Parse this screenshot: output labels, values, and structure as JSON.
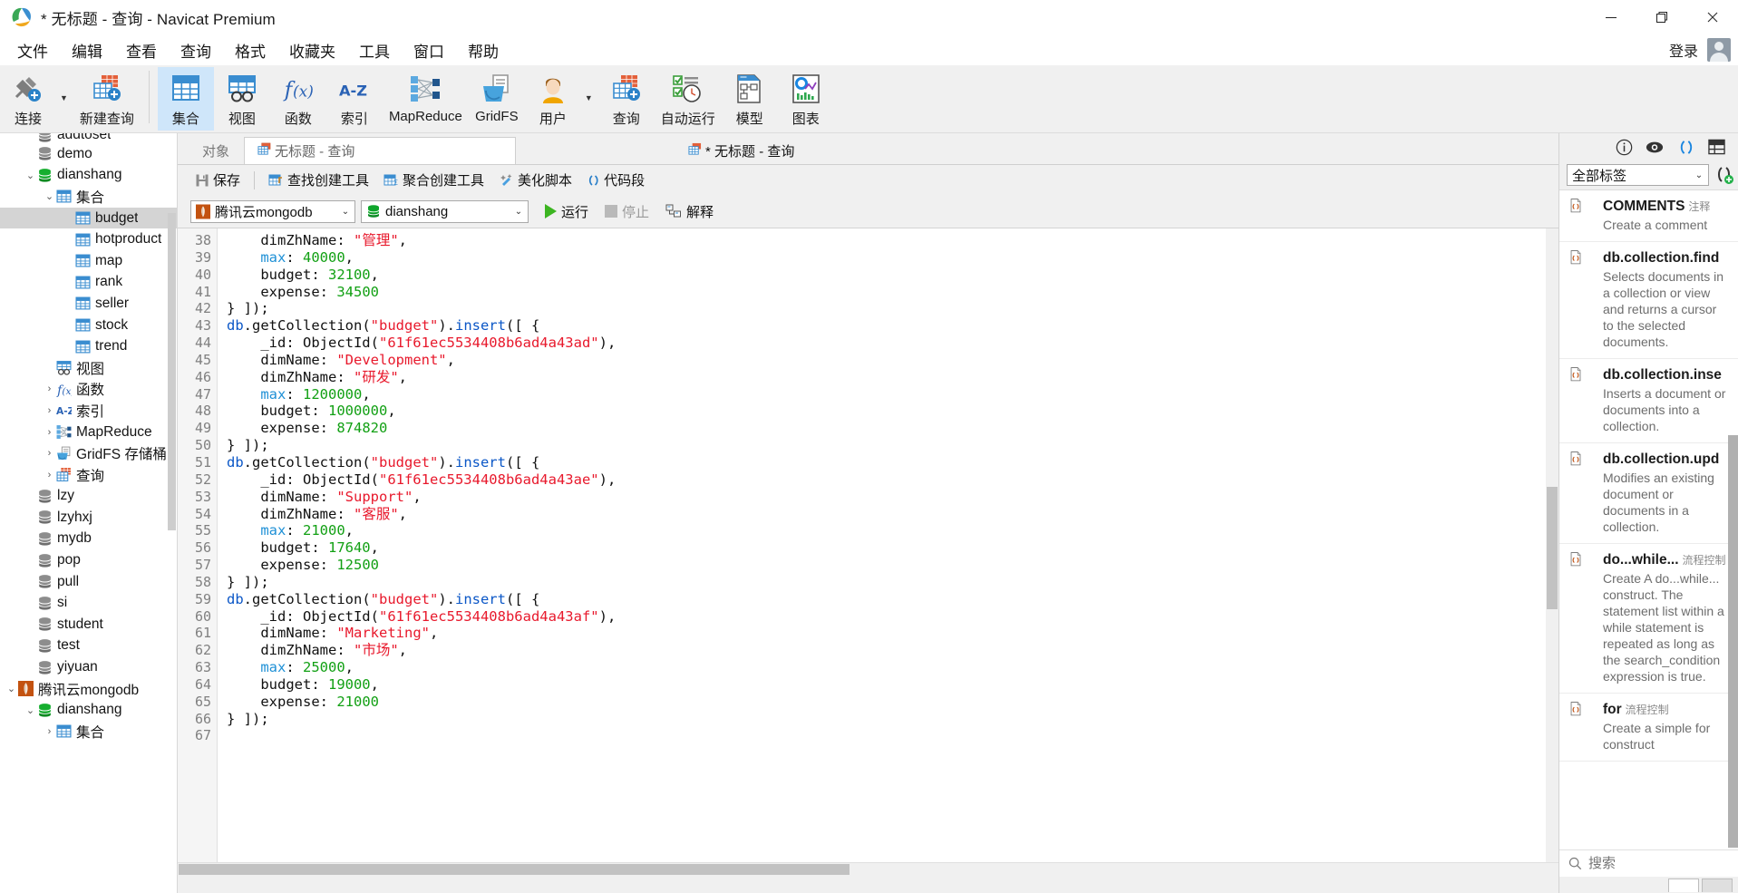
{
  "window": {
    "title": "* 无标题 - 查询 - Navicat Premium",
    "minimize": "—",
    "maximize": "❐",
    "close": "✕"
  },
  "menubar": {
    "items": [
      "文件",
      "编辑",
      "查看",
      "查询",
      "格式",
      "收藏夹",
      "工具",
      "窗口",
      "帮助"
    ],
    "login_label": "登录"
  },
  "ribbon": {
    "groups": [
      {
        "items": [
          {
            "label": "连接",
            "icon": "connection-plus-icon",
            "caret": true
          },
          {
            "label": "新建查询",
            "icon": "new-query-icon",
            "caret": false
          }
        ]
      },
      {
        "items": [
          {
            "label": "集合",
            "icon": "collection-icon",
            "active": true,
            "caret": false
          },
          {
            "label": "视图",
            "icon": "view-icon",
            "caret": false
          },
          {
            "label": "函数",
            "icon": "function-fx-icon",
            "caret": false
          },
          {
            "label": "索引",
            "icon": "index-az-icon",
            "caret": false
          },
          {
            "label": "MapReduce",
            "icon": "mapreduce-icon",
            "caret": false
          },
          {
            "label": "GridFS",
            "icon": "gridfs-bucket-icon",
            "caret": false
          },
          {
            "label": "用户",
            "icon": "user-icon",
            "caret": true
          },
          {
            "label": "查询",
            "icon": "query-icon",
            "caret": false
          },
          {
            "label": "自动运行",
            "icon": "automation-clock-icon",
            "caret": false
          },
          {
            "label": "模型",
            "icon": "model-diagram-icon",
            "caret": false
          },
          {
            "label": "图表",
            "icon": "chart-icon",
            "caret": false
          }
        ]
      }
    ]
  },
  "sidebar": {
    "nodes": [
      {
        "label": "addtoset",
        "icon": "database-grey-icon",
        "indent": 1,
        "arrow": "",
        "partial": true
      },
      {
        "label": "demo",
        "icon": "database-grey-icon",
        "indent": 1,
        "arrow": ""
      },
      {
        "label": "dianshang",
        "icon": "database-green-icon",
        "indent": 1,
        "arrow": "v"
      },
      {
        "label": "集合",
        "icon": "collection-folder-icon",
        "indent": 2,
        "arrow": "v"
      },
      {
        "label": "budget",
        "icon": "table-icon",
        "indent": 3,
        "arrow": "",
        "selected": true
      },
      {
        "label": "hotproduct",
        "icon": "table-icon",
        "indent": 3,
        "arrow": ""
      },
      {
        "label": "map",
        "icon": "table-icon",
        "indent": 3,
        "arrow": ""
      },
      {
        "label": "rank",
        "icon": "table-icon",
        "indent": 3,
        "arrow": ""
      },
      {
        "label": "seller",
        "icon": "table-icon",
        "indent": 3,
        "arrow": ""
      },
      {
        "label": "stock",
        "icon": "table-icon",
        "indent": 3,
        "arrow": ""
      },
      {
        "label": "trend",
        "icon": "table-icon",
        "indent": 3,
        "arrow": ""
      },
      {
        "label": "视图",
        "icon": "view-icon",
        "indent": 2,
        "arrow": ""
      },
      {
        "label": "函数",
        "icon": "function-fx-icon",
        "indent": 2,
        "arrow": ">"
      },
      {
        "label": "索引",
        "icon": "index-az-icon",
        "indent": 2,
        "arrow": ">"
      },
      {
        "label": "MapReduce",
        "icon": "mapreduce-icon",
        "indent": 2,
        "arrow": ">"
      },
      {
        "label": "GridFS 存储桶",
        "icon": "gridfs-bucket-icon",
        "indent": 2,
        "arrow": ">"
      },
      {
        "label": "查询",
        "icon": "query-icon",
        "indent": 2,
        "arrow": ">"
      },
      {
        "label": "lzy",
        "icon": "database-grey-icon",
        "indent": 1,
        "arrow": ""
      },
      {
        "label": "lzyhxj",
        "icon": "database-grey-icon",
        "indent": 1,
        "arrow": ""
      },
      {
        "label": "mydb",
        "icon": "database-grey-icon",
        "indent": 1,
        "arrow": ""
      },
      {
        "label": "pop",
        "icon": "database-grey-icon",
        "indent": 1,
        "arrow": ""
      },
      {
        "label": "pull",
        "icon": "database-grey-icon",
        "indent": 1,
        "arrow": ""
      },
      {
        "label": "si",
        "icon": "database-grey-icon",
        "indent": 1,
        "arrow": ""
      },
      {
        "label": "student",
        "icon": "database-grey-icon",
        "indent": 1,
        "arrow": ""
      },
      {
        "label": "test",
        "icon": "database-grey-icon",
        "indent": 1,
        "arrow": ""
      },
      {
        "label": "yiyuan",
        "icon": "database-grey-icon",
        "indent": 1,
        "arrow": ""
      },
      {
        "label": "腾讯云mongodb",
        "icon": "mongodb-leaf-icon",
        "indent": 0,
        "arrow": "v"
      },
      {
        "label": "dianshang",
        "icon": "database-green-icon",
        "indent": 1,
        "arrow": "v"
      },
      {
        "label": "集合",
        "icon": "collection-folder-icon",
        "indent": 2,
        "arrow": ">"
      }
    ]
  },
  "object_tabs": {
    "label": "对象",
    "tabs": [
      {
        "label": "无标题 - 查询",
        "icon": "query-icon",
        "active": false
      },
      {
        "label": "* 无标题 - 查询",
        "icon": "query-icon",
        "active": true
      }
    ]
  },
  "query_toolbar": {
    "buttons": [
      {
        "label": "保存",
        "icon": "save-icon"
      },
      {
        "label": "查找创建工具",
        "icon": "find-builder-icon"
      },
      {
        "label": "聚合创建工具",
        "icon": "aggregate-builder-icon"
      },
      {
        "label": "美化脚本",
        "icon": "beautify-icon"
      },
      {
        "label": "代码段",
        "icon": "snippet-parens-icon"
      }
    ]
  },
  "conn_bar": {
    "connection": "腾讯云mongodb",
    "database": "dianshang",
    "run_label": "运行",
    "stop_label": "停止",
    "explain_label": "解释"
  },
  "editor": {
    "first_line": 38,
    "lines": [
      {
        "n": 38,
        "fold": "",
        "tokens": [
          {
            "t": "    dimZhName: ",
            "c": "pl"
          },
          {
            "t": "\"管理\"",
            "c": "str"
          },
          {
            "t": ",",
            "c": "pl"
          }
        ]
      },
      {
        "n": 39,
        "fold": "",
        "tokens": [
          {
            "t": "    ",
            "c": "pl"
          },
          {
            "t": "max",
            "c": "key"
          },
          {
            "t": ": ",
            "c": "pl"
          },
          {
            "t": "40000",
            "c": "num"
          },
          {
            "t": ",",
            "c": "pl"
          }
        ]
      },
      {
        "n": 40,
        "fold": "",
        "tokens": [
          {
            "t": "    budget: ",
            "c": "pl"
          },
          {
            "t": "32100",
            "c": "num"
          },
          {
            "t": ",",
            "c": "pl"
          }
        ]
      },
      {
        "n": 41,
        "fold": "",
        "tokens": [
          {
            "t": "    expense: ",
            "c": "pl"
          },
          {
            "t": "34500",
            "c": "num"
          }
        ]
      },
      {
        "n": 42,
        "fold": "end",
        "tokens": [
          {
            "t": "} ]);",
            "c": "pl"
          }
        ]
      },
      {
        "n": 43,
        "fold": "start",
        "tokens": [
          {
            "t": "db",
            "c": "db"
          },
          {
            "t": ".getCollection(",
            "c": "pl"
          },
          {
            "t": "\"budget\"",
            "c": "str"
          },
          {
            "t": ").",
            "c": "pl"
          },
          {
            "t": "insert",
            "c": "fn"
          },
          {
            "t": "([ {",
            "c": "pl"
          }
        ]
      },
      {
        "n": 44,
        "fold": "",
        "tokens": [
          {
            "t": "    _id: ObjectId(",
            "c": "pl"
          },
          {
            "t": "\"61f61ec5534408b6ad4a43ad\"",
            "c": "str"
          },
          {
            "t": "),",
            "c": "pl"
          }
        ]
      },
      {
        "n": 45,
        "fold": "",
        "tokens": [
          {
            "t": "    dimName: ",
            "c": "pl"
          },
          {
            "t": "\"Development\"",
            "c": "str"
          },
          {
            "t": ",",
            "c": "pl"
          }
        ]
      },
      {
        "n": 46,
        "fold": "",
        "tokens": [
          {
            "t": "    dimZhName: ",
            "c": "pl"
          },
          {
            "t": "\"研发\"",
            "c": "str"
          },
          {
            "t": ",",
            "c": "pl"
          }
        ]
      },
      {
        "n": 47,
        "fold": "",
        "tokens": [
          {
            "t": "    ",
            "c": "pl"
          },
          {
            "t": "max",
            "c": "key"
          },
          {
            "t": ": ",
            "c": "pl"
          },
          {
            "t": "1200000",
            "c": "num"
          },
          {
            "t": ",",
            "c": "pl"
          }
        ]
      },
      {
        "n": 48,
        "fold": "",
        "tokens": [
          {
            "t": "    budget: ",
            "c": "pl"
          },
          {
            "t": "1000000",
            "c": "num"
          },
          {
            "t": ",",
            "c": "pl"
          }
        ]
      },
      {
        "n": 49,
        "fold": "",
        "tokens": [
          {
            "t": "    expense: ",
            "c": "pl"
          },
          {
            "t": "874820",
            "c": "num"
          }
        ]
      },
      {
        "n": 50,
        "fold": "end",
        "tokens": [
          {
            "t": "} ]);",
            "c": "pl"
          }
        ]
      },
      {
        "n": 51,
        "fold": "start",
        "tokens": [
          {
            "t": "db",
            "c": "db"
          },
          {
            "t": ".getCollection(",
            "c": "pl"
          },
          {
            "t": "\"budget\"",
            "c": "str"
          },
          {
            "t": ").",
            "c": "pl"
          },
          {
            "t": "insert",
            "c": "fn"
          },
          {
            "t": "([ {",
            "c": "pl"
          }
        ]
      },
      {
        "n": 52,
        "fold": "",
        "tokens": [
          {
            "t": "    _id: ObjectId(",
            "c": "pl"
          },
          {
            "t": "\"61f61ec5534408b6ad4a43ae\"",
            "c": "str"
          },
          {
            "t": "),",
            "c": "pl"
          }
        ]
      },
      {
        "n": 53,
        "fold": "",
        "tokens": [
          {
            "t": "    dimName: ",
            "c": "pl"
          },
          {
            "t": "\"Support\"",
            "c": "str"
          },
          {
            "t": ",",
            "c": "pl"
          }
        ]
      },
      {
        "n": 54,
        "fold": "",
        "tokens": [
          {
            "t": "    dimZhName: ",
            "c": "pl"
          },
          {
            "t": "\"客服\"",
            "c": "str"
          },
          {
            "t": ",",
            "c": "pl"
          }
        ]
      },
      {
        "n": 55,
        "fold": "",
        "tokens": [
          {
            "t": "    ",
            "c": "pl"
          },
          {
            "t": "max",
            "c": "key"
          },
          {
            "t": ": ",
            "c": "pl"
          },
          {
            "t": "21000",
            "c": "num"
          },
          {
            "t": ",",
            "c": "pl"
          }
        ]
      },
      {
        "n": 56,
        "fold": "",
        "tokens": [
          {
            "t": "    budget: ",
            "c": "pl"
          },
          {
            "t": "17640",
            "c": "num"
          },
          {
            "t": ",",
            "c": "pl"
          }
        ]
      },
      {
        "n": 57,
        "fold": "",
        "tokens": [
          {
            "t": "    expense: ",
            "c": "pl"
          },
          {
            "t": "12500",
            "c": "num"
          }
        ]
      },
      {
        "n": 58,
        "fold": "end",
        "tokens": [
          {
            "t": "} ]);",
            "c": "pl"
          }
        ]
      },
      {
        "n": 59,
        "fold": "start",
        "tokens": [
          {
            "t": "db",
            "c": "db"
          },
          {
            "t": ".getCollection(",
            "c": "pl"
          },
          {
            "t": "\"budget\"",
            "c": "str"
          },
          {
            "t": ").",
            "c": "pl"
          },
          {
            "t": "insert",
            "c": "fn"
          },
          {
            "t": "([ {",
            "c": "pl"
          }
        ]
      },
      {
        "n": 60,
        "fold": "",
        "tokens": [
          {
            "t": "    _id: ObjectId(",
            "c": "pl"
          },
          {
            "t": "\"61f61ec5534408b6ad4a43af\"",
            "c": "str"
          },
          {
            "t": "),",
            "c": "pl"
          }
        ]
      },
      {
        "n": 61,
        "fold": "",
        "tokens": [
          {
            "t": "    dimName: ",
            "c": "pl"
          },
          {
            "t": "\"Marketing\"",
            "c": "str"
          },
          {
            "t": ",",
            "c": "pl"
          }
        ]
      },
      {
        "n": 62,
        "fold": "",
        "tokens": [
          {
            "t": "    dimZhName: ",
            "c": "pl"
          },
          {
            "t": "\"市场\"",
            "c": "str"
          },
          {
            "t": ",",
            "c": "pl"
          }
        ]
      },
      {
        "n": 63,
        "fold": "",
        "tokens": [
          {
            "t": "    ",
            "c": "pl"
          },
          {
            "t": "max",
            "c": "key"
          },
          {
            "t": ": ",
            "c": "pl"
          },
          {
            "t": "25000",
            "c": "num"
          },
          {
            "t": ",",
            "c": "pl"
          }
        ]
      },
      {
        "n": 64,
        "fold": "",
        "tokens": [
          {
            "t": "    budget: ",
            "c": "pl"
          },
          {
            "t": "19000",
            "c": "num"
          },
          {
            "t": ",",
            "c": "pl"
          }
        ]
      },
      {
        "n": 65,
        "fold": "",
        "tokens": [
          {
            "t": "    expense: ",
            "c": "pl"
          },
          {
            "t": "21000",
            "c": "num"
          }
        ]
      },
      {
        "n": 66,
        "fold": "end",
        "tokens": [
          {
            "t": "} ]);",
            "c": "pl"
          }
        ]
      },
      {
        "n": 67,
        "fold": "",
        "tokens": [
          {
            "t": "",
            "c": "pl"
          }
        ]
      }
    ]
  },
  "right_panel": {
    "icons": [
      "info-icon",
      "eye-icon",
      "snippet-parens-icon",
      "grid-icon"
    ],
    "filter_value": "全部标签",
    "add_snippet_icon": "add-snippet-icon",
    "search_placeholder": "搜索",
    "snippets": [
      {
        "title": "COMMENTS",
        "cat": "注释",
        "desc": "Create a comment"
      },
      {
        "title": "db.collection.find",
        "cat": "",
        "desc": "Selects documents in a collection or view and returns a cursor to the selected documents."
      },
      {
        "title": "db.collection.inse",
        "cat": "",
        "desc": "Inserts a document or documents into a collection."
      },
      {
        "title": "db.collection.upd",
        "cat": "",
        "desc": "Modifies an existing document or documents in a collection."
      },
      {
        "title": "do...while...",
        "cat": "流程控制",
        "desc": "Create A do...while... construct. The statement list within a while statement is repeated as long as the search_condition expression is true."
      },
      {
        "title": "for",
        "cat": "流程控制",
        "desc": "Create a simple for construct"
      }
    ]
  },
  "colors": {
    "accent_blue": "#2a7fc9",
    "mongo_orange": "#c35210",
    "green_db": "#0fa62c",
    "string_red": "#e8192c",
    "number_green": "#12a014",
    "keyword_blue": "#0b57c7"
  }
}
